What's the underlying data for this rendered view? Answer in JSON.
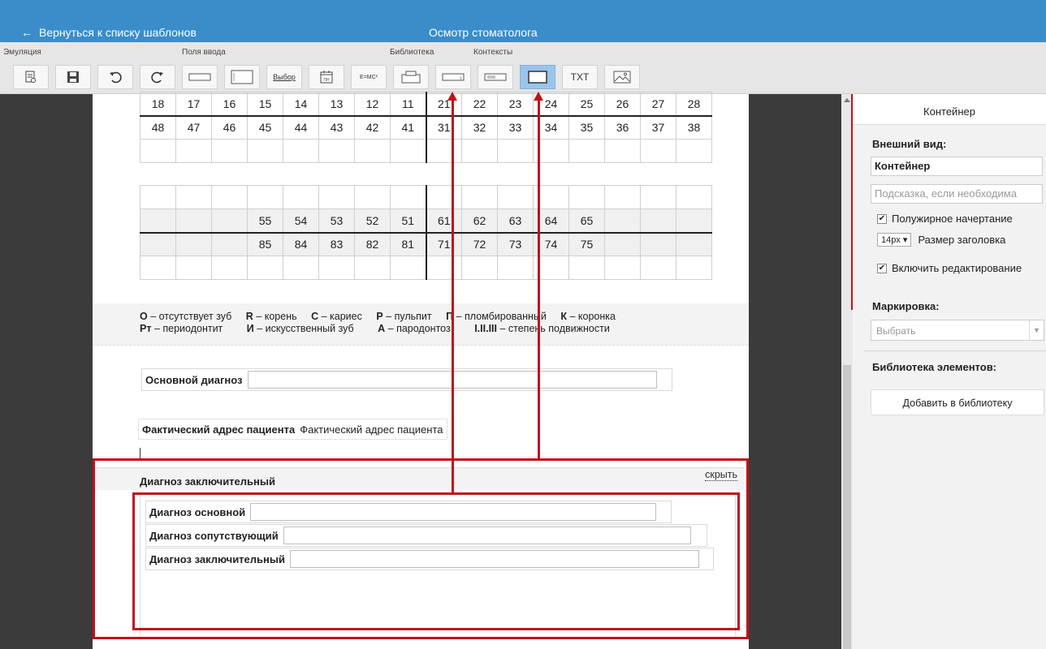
{
  "topbar": {
    "back_label": "Вернуться к списку шаблонов",
    "title": "Осмотр стоматолога"
  },
  "toolbar": {
    "groups": {
      "emulation": "Эмуляция",
      "inputs": "Поля ввода",
      "library": "Библиотека",
      "contexts": "Контексты"
    },
    "buttons": {
      "choice_label": "Выбор",
      "date_label": "ПН",
      "formula_label": "E=MC²",
      "txt_label": "TXT"
    }
  },
  "teeth": {
    "upper_permanent": [
      "18",
      "17",
      "16",
      "15",
      "14",
      "13",
      "12",
      "11",
      "21",
      "22",
      "23",
      "24",
      "25",
      "26",
      "27",
      "28"
    ],
    "lower_permanent": [
      "48",
      "47",
      "46",
      "45",
      "44",
      "43",
      "42",
      "41",
      "31",
      "32",
      "33",
      "34",
      "35",
      "36",
      "37",
      "38"
    ],
    "upper_primary": [
      "",
      "",
      "",
      "55",
      "54",
      "53",
      "52",
      "51",
      "61",
      "62",
      "63",
      "64",
      "65",
      "",
      "",
      ""
    ],
    "lower_primary": [
      "",
      "",
      "",
      "85",
      "84",
      "83",
      "82",
      "81",
      "71",
      "72",
      "73",
      "74",
      "75",
      "",
      "",
      ""
    ]
  },
  "legend": {
    "row1": [
      {
        "k": "О",
        "v": " – отсутствует зуб"
      },
      {
        "k": "R",
        "v": " – корень"
      },
      {
        "k": "С",
        "v": " – кариес"
      },
      {
        "k": "Р",
        "v": " – пульпит"
      },
      {
        "k": "П",
        "v": " – пломбированный"
      },
      {
        "k": "К",
        "v": " – коронка"
      }
    ],
    "row2": [
      {
        "k": "Рт",
        "v": " – периодонтит"
      },
      {
        "k": "И",
        "v": " – искусственный зуб"
      },
      {
        "k": "А",
        "v": " – пародонтоз"
      },
      {
        "k": "I.II.III",
        "v": " – степень подвижности"
      }
    ]
  },
  "form": {
    "main_diagnosis_label": "Основной диагноз",
    "address_label": "Фактический адрес пациента",
    "address_value": "Фактический адрес пациента",
    "container_title": "Диагноз заключительный",
    "hide_link": "скрыть",
    "diag_main_label": "Диагноз основной",
    "diag_concomitant_label": "Диагноз сопутствующий",
    "diag_final_label": "Диагноз заключительный"
  },
  "panel": {
    "title": "Контейнер",
    "appearance_label": "Внешний вид:",
    "name_value": "Контейнер",
    "hint_placeholder": "Подсказка, если необходима",
    "bold_label": "Полужирное начертание",
    "size_value": "14px ▾",
    "size_label": "Размер заголовка",
    "editing_label": "Включить редактирование",
    "marking_label": "Маркировка:",
    "marking_placeholder": "Выбрать",
    "library_label": "Библиотека элементов:",
    "add_library_button": "Добавить в библиотеку"
  },
  "colors": {
    "topbar": "#3a8dc9",
    "highlight": "#c0121b",
    "active_button": "#9cc4ea"
  }
}
